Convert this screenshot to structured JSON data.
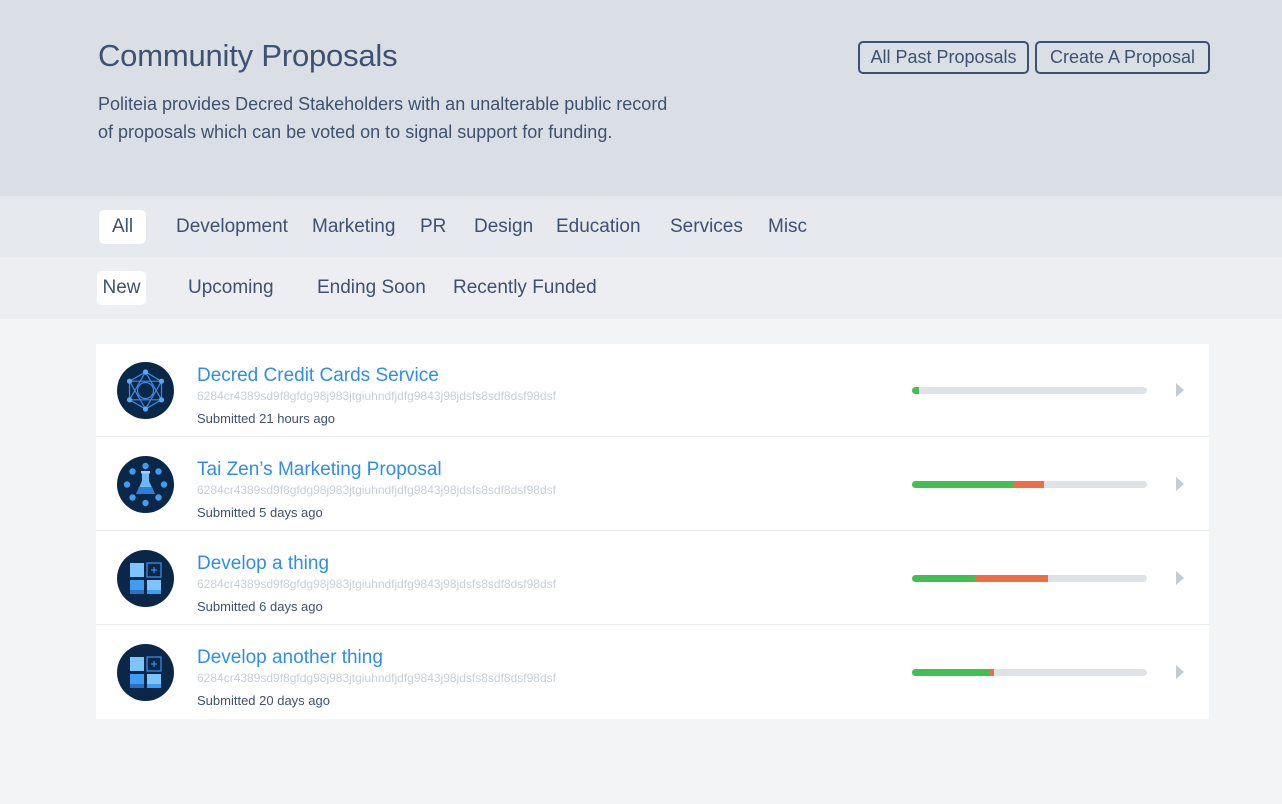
{
  "header": {
    "title": "Community Proposals",
    "description_line1": "Politeia provides Decred Stakeholders with an unalterable public record",
    "description_line2": "of proposals which can be voted on to signal support for funding.",
    "all_past_label": "All Past Proposals",
    "create_label": "Create A Proposal"
  },
  "categories": [
    "All",
    "Development",
    "Marketing",
    "PR",
    "Design",
    "Education",
    "Services",
    "Misc"
  ],
  "sort_tabs": [
    "New",
    "Upcoming",
    "Ending Soon",
    "Recently Funded"
  ],
  "colors": {
    "yes": "#41bf53",
    "no": "#ed6d47",
    "link": "#2f8eec"
  },
  "proposals": [
    {
      "title": "Decred Credit Cards Service",
      "hash": "6284cr4389sd9f8gfdg98j983jtgiuhndfjdfg9843j98jdsfs8sdf8dsf98dsf",
      "submitted": "Submitted 21 hours ago",
      "icon": "network-hexagon-icon",
      "yes": 0.03,
      "no": 0.0
    },
    {
      "title": "Tai Zen’s Marketing Proposal",
      "hash": "6284cr4389sd9f8gfdg98j983jtgiuhndfjdfg9843j98jdsfs8sdf8dsf98dsf",
      "submitted": "Submitted 5 days ago",
      "icon": "flask-network-icon",
      "yes": 0.43,
      "no": 0.13
    },
    {
      "title": "Develop a thing",
      "hash": "6284cr4389sd9f8gfdg98j983jtgiuhndfjdfg9843j98jdsfs8sdf8dsf98dsf",
      "submitted": "Submitted 6 days ago",
      "icon": "grid-blocks-icon",
      "yes": 0.27,
      "no": 0.31
    },
    {
      "title": "Develop another thing",
      "hash": "6284cr4389sd9f8gfdg98j983jtgiuhndfjdfg9843j98jdsfs8sdf8dsf98dsf",
      "submitted": "Submitted 20 days ago",
      "icon": "grid-blocks-icon",
      "yes": 0.33,
      "no": 0.02
    }
  ]
}
